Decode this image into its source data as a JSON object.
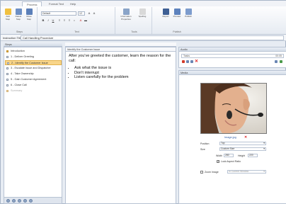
{
  "tabs": [
    "Process",
    "Format Text",
    "Help"
  ],
  "ribbon": {
    "clipboard_buttons": [
      "Add Step",
      "Delete Step",
      "Move Step"
    ],
    "steps_group_label": "Steps",
    "font_name": "Default",
    "font_size": "12",
    "text_group_label": "Text",
    "tools": [
      "Information Properties",
      "Spelling"
    ],
    "tools_group_label": "Tools",
    "publish_buttons": [
      "Report",
      "Preview",
      "Publish"
    ],
    "publish_group_label": "Publish"
  },
  "title_field": {
    "label": "Instruction Title",
    "value": "Call Handling Procedure"
  },
  "steps_panel": {
    "header": "Steps",
    "items": [
      {
        "label": "Introduction",
        "type": "folder"
      },
      {
        "label": "1 - Deliver Greeting",
        "type": "step"
      },
      {
        "label": "2 - Identify the Customer Issue",
        "type": "step"
      },
      {
        "label": "3 - Escalate Issue and Dispatcher",
        "type": "step"
      },
      {
        "label": "4 - Take Ownership",
        "type": "step"
      },
      {
        "label": "5 - Gain Customer Agreement",
        "type": "step"
      },
      {
        "label": "6 - Close Call",
        "type": "step"
      },
      {
        "label": "Summary",
        "type": "folder"
      }
    ]
  },
  "editor": {
    "header": "Identify the Customer Issue",
    "paragraph": "After you've greeted the customer, learn the reason for the call:",
    "bullets": [
      "Ask what the issue is",
      "Don't interrupt",
      "Listen carefully for the problem"
    ]
  },
  "audio_panel": {
    "header": "Audio",
    "field_value": "Tasks",
    "field_time": "00:05"
  },
  "media_panel": {
    "header": "Media",
    "image_caption": "Image.jpg",
    "position_label": "Position",
    "position_value": "Top",
    "size_label": "Size",
    "size_value": "Custom Size",
    "width_label": "Width",
    "width_value": "280",
    "height_label": "Height",
    "height_value": "220",
    "lock_label": "Lock Aspect Ratio",
    "zoom_label": "Zoom Image",
    "zoom_value": "In Current Window"
  },
  "colors": {
    "selection": "#f8d58a",
    "panel_border": "#b8c3d3",
    "delete_red": "#dd2222"
  }
}
